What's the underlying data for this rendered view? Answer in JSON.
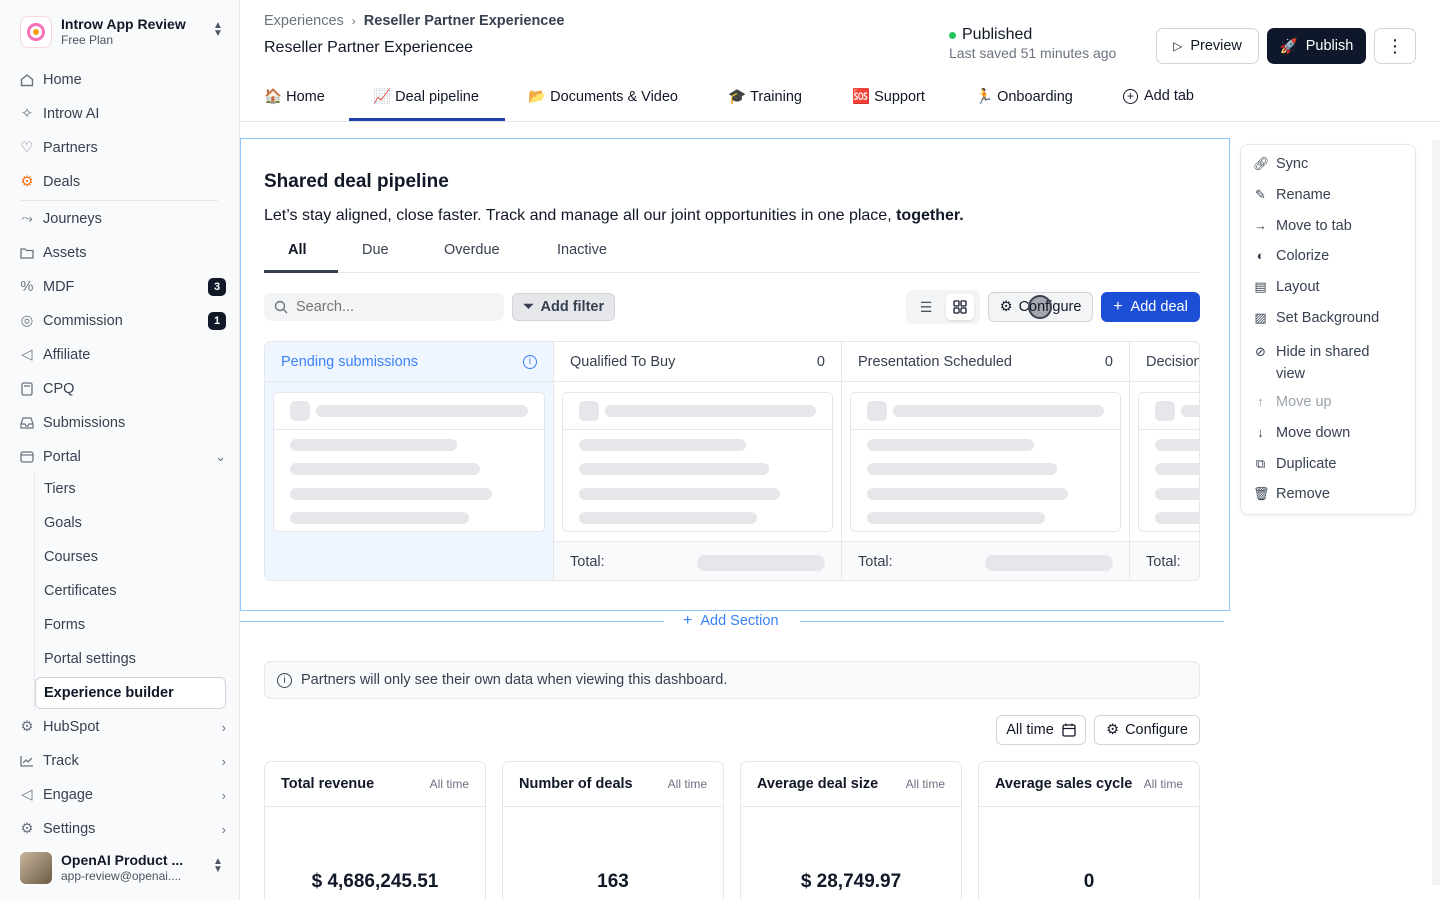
{
  "org": {
    "name": "Introw App Review",
    "plan": "Free Plan"
  },
  "sidebar": {
    "items": [
      {
        "label": "Home",
        "icon": "home-icon"
      },
      {
        "label": "Introw AI",
        "icon": "sparkle-icon"
      },
      {
        "label": "Partners",
        "icon": "heart-handshake-icon"
      },
      {
        "label": "Deals",
        "icon": "hubspot-icon"
      },
      {
        "label": "Journeys",
        "icon": "route-icon"
      },
      {
        "label": "Assets",
        "icon": "folder-icon"
      },
      {
        "label": "MDF",
        "icon": "percent-icon",
        "badge": "3"
      },
      {
        "label": "Commission",
        "icon": "coins-icon",
        "badge": "1"
      },
      {
        "label": "Affiliate",
        "icon": "megaphone-icon"
      },
      {
        "label": "CPQ",
        "icon": "calculator-icon"
      },
      {
        "label": "Submissions",
        "icon": "inbox-icon"
      },
      {
        "label": "Portal",
        "icon": "portal-icon"
      }
    ],
    "portal_children": [
      "Tiers",
      "Goals",
      "Courses",
      "Certificates",
      "Forms",
      "Portal settings",
      "Experience builder"
    ],
    "bottom_items": [
      {
        "label": "HubSpot",
        "icon": "hubspot-icon"
      },
      {
        "label": "Track",
        "icon": "chart-icon"
      },
      {
        "label": "Engage",
        "icon": "megaphone-icon"
      },
      {
        "label": "Settings",
        "icon": "gear-icon"
      }
    ],
    "user": {
      "name": "OpenAI Product ...",
      "email": "app-review@openai...."
    }
  },
  "header": {
    "breadcrumb_root": "Experiences",
    "breadcrumb_current": "Reseller Partner Experiencee",
    "title": "Reseller Partner Experiencee",
    "status": "Published",
    "last_saved": "Last saved 51 minutes ago",
    "preview_label": "Preview",
    "publish_label": "Publish",
    "status_color": "#22c55e"
  },
  "tabs": [
    {
      "emoji": "🏠",
      "label": "Home"
    },
    {
      "emoji": "📈",
      "label": "Deal pipeline"
    },
    {
      "emoji": "📂",
      "label": "Documents & Video"
    },
    {
      "emoji": "🎓",
      "label": "Training"
    },
    {
      "emoji": "🆘",
      "label": "Support"
    },
    {
      "emoji": "🏃",
      "label": "Onboarding"
    },
    {
      "emoji": "",
      "label": "Add tab"
    }
  ],
  "section": {
    "title": "Shared deal pipeline",
    "subtitle": "Let’s stay aligned, close faster. Track and manage all our joint opportunities in one place,",
    "subtitle_bold": "together.",
    "filters": [
      "All",
      "Due",
      "Overdue",
      "Inactive"
    ],
    "search_placeholder": "Search...",
    "add_filter_label": "Add filter",
    "configure_label": "Configure",
    "add_deal_label": "Add deal",
    "columns": [
      {
        "name": "Pending submissions",
        "count": ""
      },
      {
        "name": "Qualified To Buy",
        "count": "0"
      },
      {
        "name": "Presentation Scheduled",
        "count": "0"
      },
      {
        "name": "Decision",
        "count": ""
      }
    ],
    "total_label": "Total:"
  },
  "add_section_label": "Add Section",
  "info_text": "Partners will only see their own data when viewing this dashboard.",
  "dashboard": {
    "period_label": "All time",
    "configure_label": "Configure",
    "kpis": [
      {
        "title": "Total revenue",
        "period": "All time",
        "value": "$ 4,686,245.51"
      },
      {
        "title": "Number of deals",
        "period": "All time",
        "value": "163"
      },
      {
        "title": "Average deal size",
        "period": "All time",
        "value": "$ 28,749.97"
      },
      {
        "title": "Average sales cycle",
        "period": "All time",
        "value": "0"
      }
    ]
  },
  "context_menu": {
    "items": [
      {
        "label": "Sync",
        "icon": "link-icon",
        "disabled": false
      },
      {
        "label": "Rename",
        "icon": "pencil-icon",
        "disabled": false
      },
      {
        "label": "Move to tab",
        "icon": "arrow-right-icon",
        "disabled": false
      },
      {
        "label": "Colorize",
        "icon": "palette-icon",
        "disabled": false
      },
      {
        "label": "Layout",
        "icon": "layout-icon",
        "disabled": false
      },
      {
        "label": "Set Background",
        "icon": "image-icon",
        "disabled": false
      },
      {
        "label": "Hide in shared view",
        "icon": "eye-off-icon",
        "disabled": false
      },
      {
        "label": "Move up",
        "icon": "arrow-up-icon",
        "disabled": true
      },
      {
        "label": "Move down",
        "icon": "arrow-down-icon",
        "disabled": false
      },
      {
        "label": "Duplicate",
        "icon": "copy-icon",
        "disabled": false
      },
      {
        "label": "Remove",
        "icon": "trash-icon",
        "disabled": false
      }
    ]
  }
}
